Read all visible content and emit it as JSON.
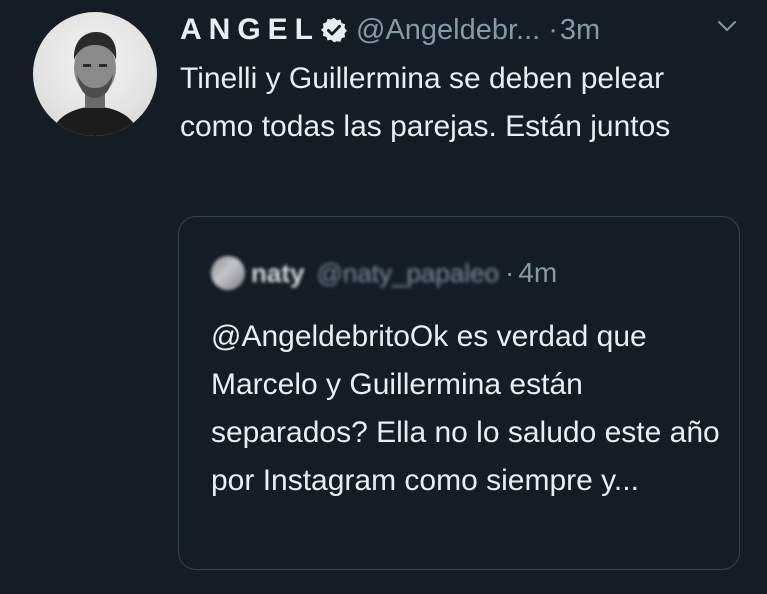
{
  "tweet": {
    "author": {
      "display_name": "ANGEL",
      "verified": true,
      "handle": "@Angeldebr...",
      "avatar_icon": "profile-photo"
    },
    "separator": "·",
    "time": "3m",
    "menu_icon": "chevron-down-icon",
    "text": "Tinelli y Guillermina se deben pelear como todas las parejas. Están juntos"
  },
  "quoted_tweet": {
    "author": {
      "display_name": "naty",
      "handle": "@naty_papaleo"
    },
    "separator": "·",
    "time": "4m",
    "text": "@AngeldebritoOk es verdad que Marcelo y Guillermina están separados? Ella no lo saludo este año por Instagram como siempre y..."
  },
  "colors": {
    "background": "#141d26",
    "text": "#e9eef2",
    "secondary_text": "#8899a6",
    "border": "#38444d"
  }
}
